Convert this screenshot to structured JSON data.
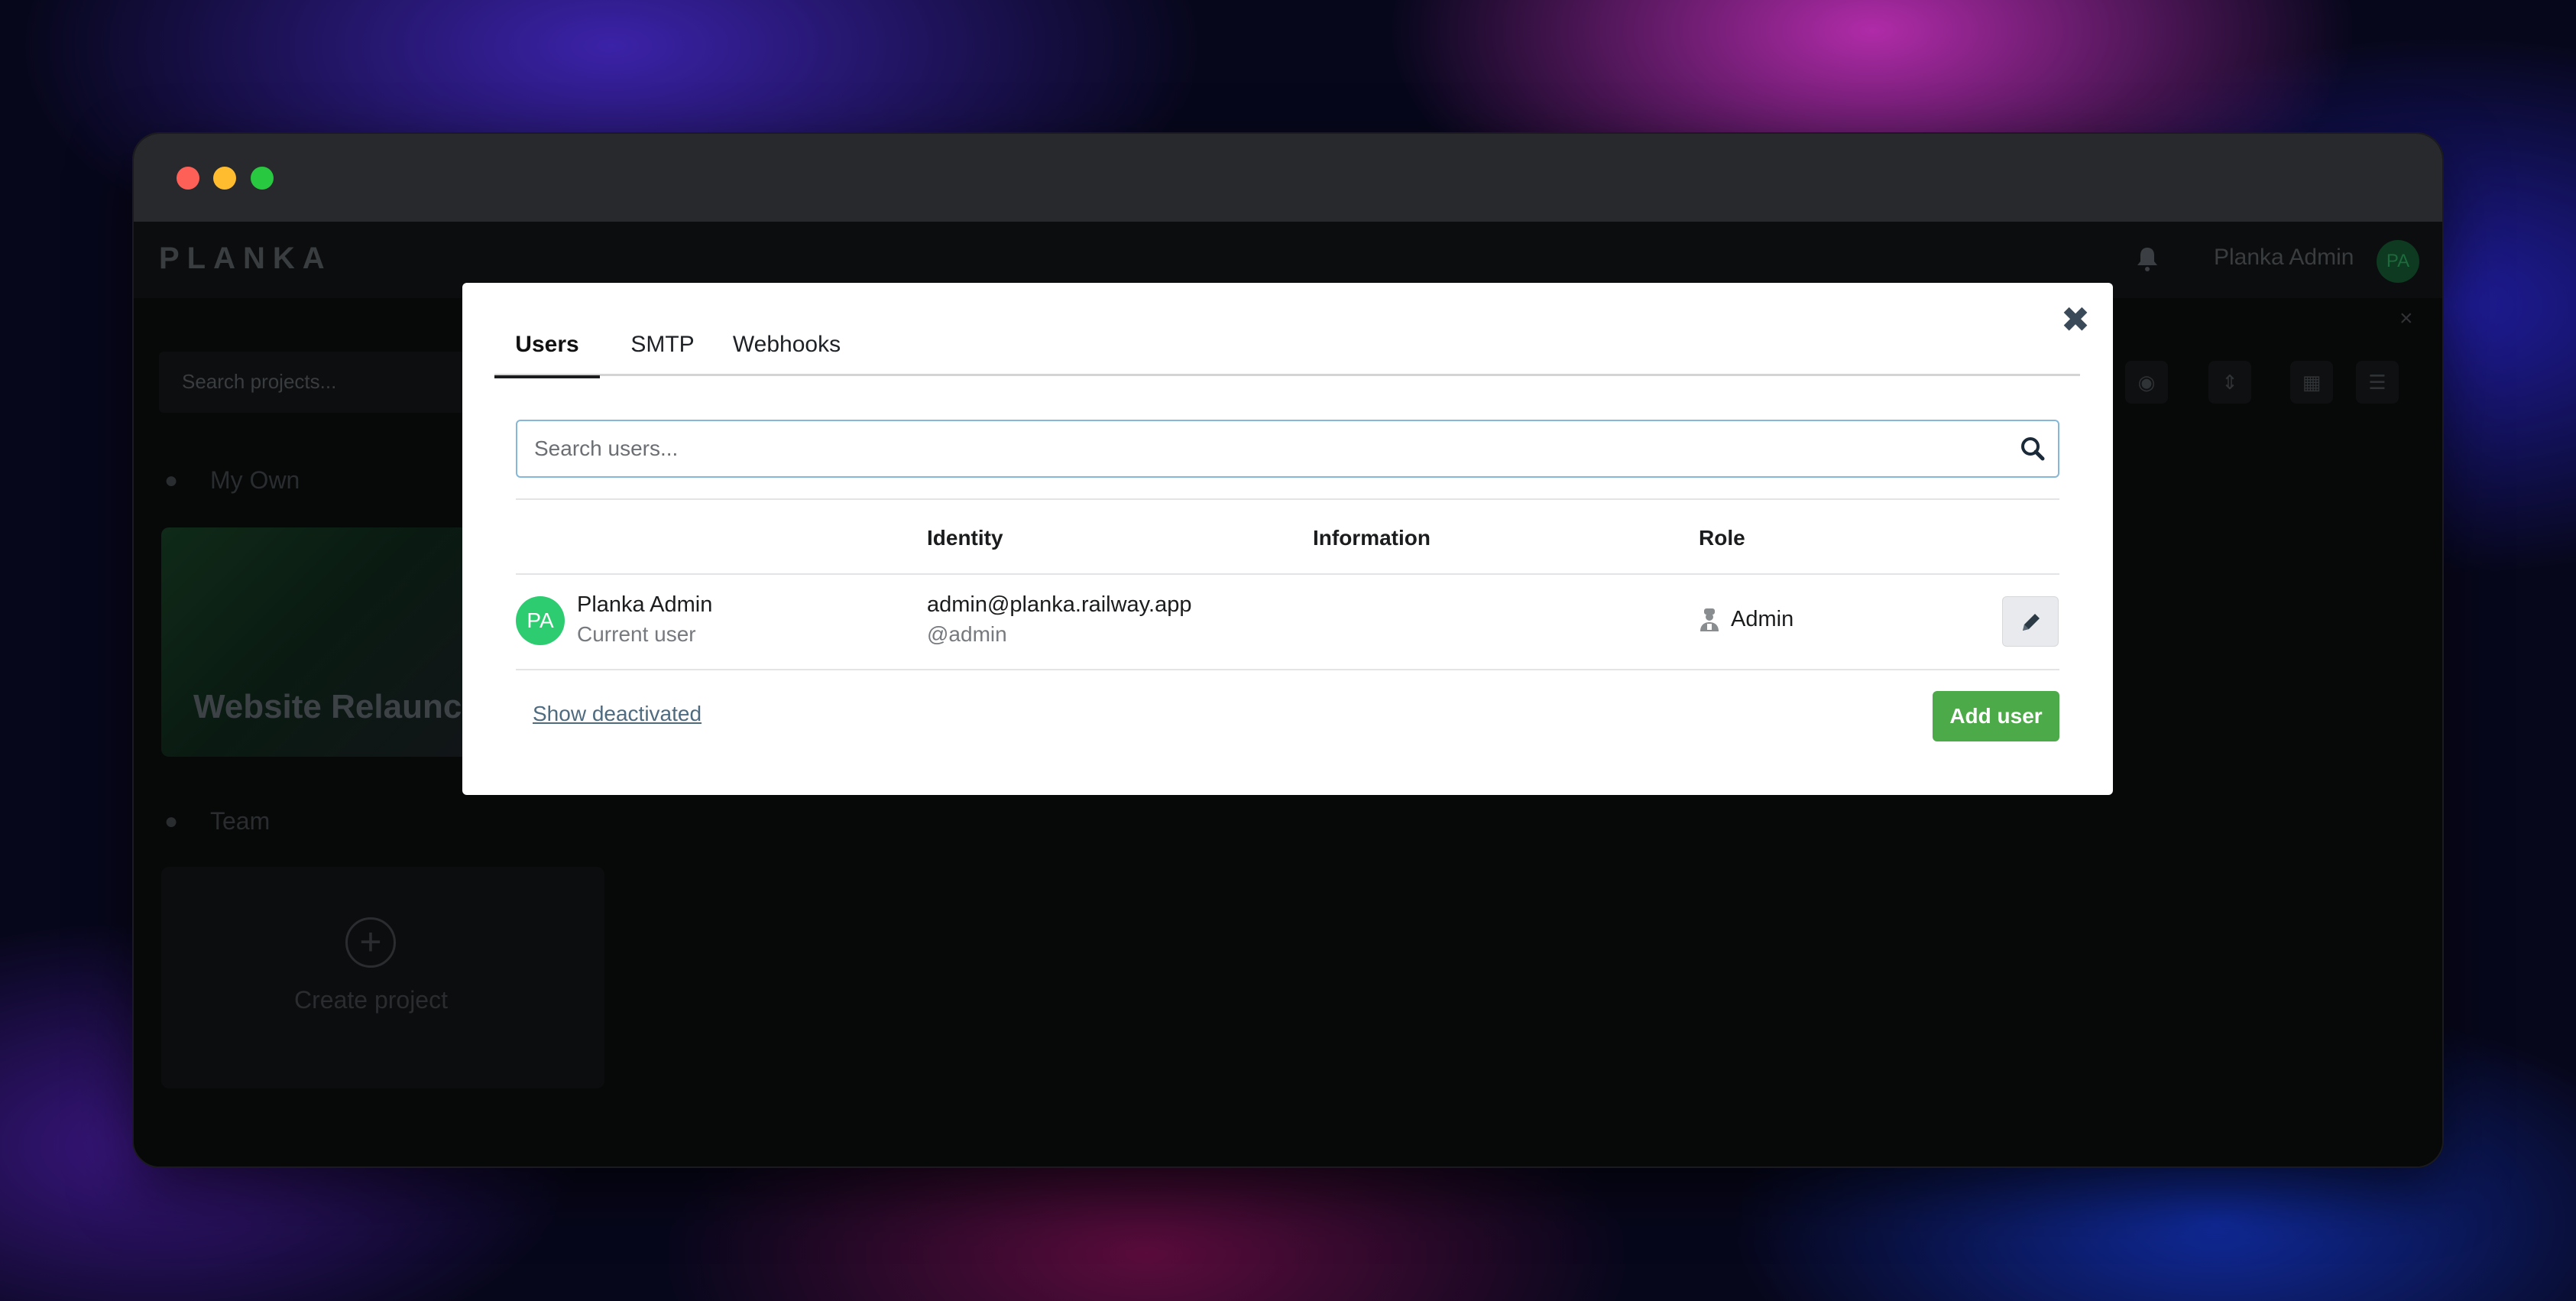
{
  "app": {
    "brand": "PLANKA",
    "header_user": "Planka Admin",
    "header_avatar": "PA",
    "projects_search_placeholder": "Search projects...",
    "section_my_own": "My Own",
    "project_title": "Website Relaunch",
    "section_team": "Team",
    "create_project": "Create project"
  },
  "modal": {
    "tabs": [
      {
        "label": "Users",
        "active": true
      },
      {
        "label": "SMTP",
        "active": false
      },
      {
        "label": "Webhooks",
        "active": false
      }
    ],
    "close_icon": "close-icon",
    "search": {
      "placeholder": "Search users...",
      "value": ""
    },
    "table": {
      "headers": {
        "identity": "Identity",
        "information": "Information",
        "role": "Role"
      },
      "rows": [
        {
          "avatar": "PA",
          "avatar_color": "#2ecc71",
          "name": "Planka Admin",
          "subtitle": "Current user",
          "email": "admin@planka.railway.app",
          "username": "@admin",
          "information": "",
          "role": "Admin",
          "role_icon": "admin-icon",
          "edit_icon": "pencil-icon"
        }
      ]
    },
    "show_deactivated": "Show deactivated",
    "add_user": "Add user"
  },
  "colors": {
    "accent_green": "#4daa48",
    "avatar_green": "#2ecc71",
    "search_border": "#85b7d9",
    "titlebar": "#28292d"
  }
}
